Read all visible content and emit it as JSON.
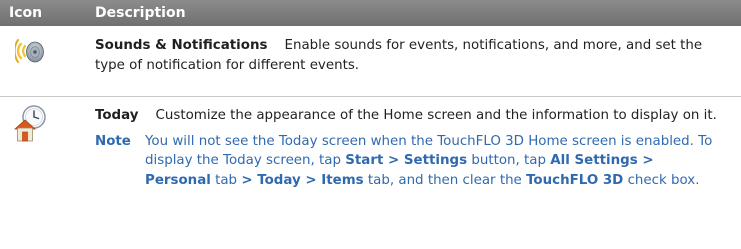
{
  "header": {
    "icon_col": "Icon",
    "desc_col": "Description"
  },
  "rows": [
    {
      "icon": "sound-notification-icon",
      "term": "Sounds & Notifications",
      "description": "Enable sounds for events, notifications, and more, and set the type of notification for different events."
    },
    {
      "icon": "today-home-icon",
      "term": "Today",
      "description": "Customize the appearance of the Home screen and the information to display on it.",
      "note": {
        "label": "Note",
        "text_1": "You will not see the Today screen when the TouchFLO 3D Home screen is enabled. To display the Today screen, tap ",
        "bold_1": "Start > Settings",
        "text_2": " button, tap ",
        "bold_2": "All Settings > Personal",
        "text_3": " tab ",
        "bold_3": "> Today > Items",
        "text_4": " tab, and then clear the ",
        "bold_4": "TouchFLO 3D",
        "text_5": " check box."
      }
    }
  ],
  "colors": {
    "header_bg": "#7a7a7a",
    "note_text": "#2f6ab0",
    "body_text": "#231f20"
  }
}
